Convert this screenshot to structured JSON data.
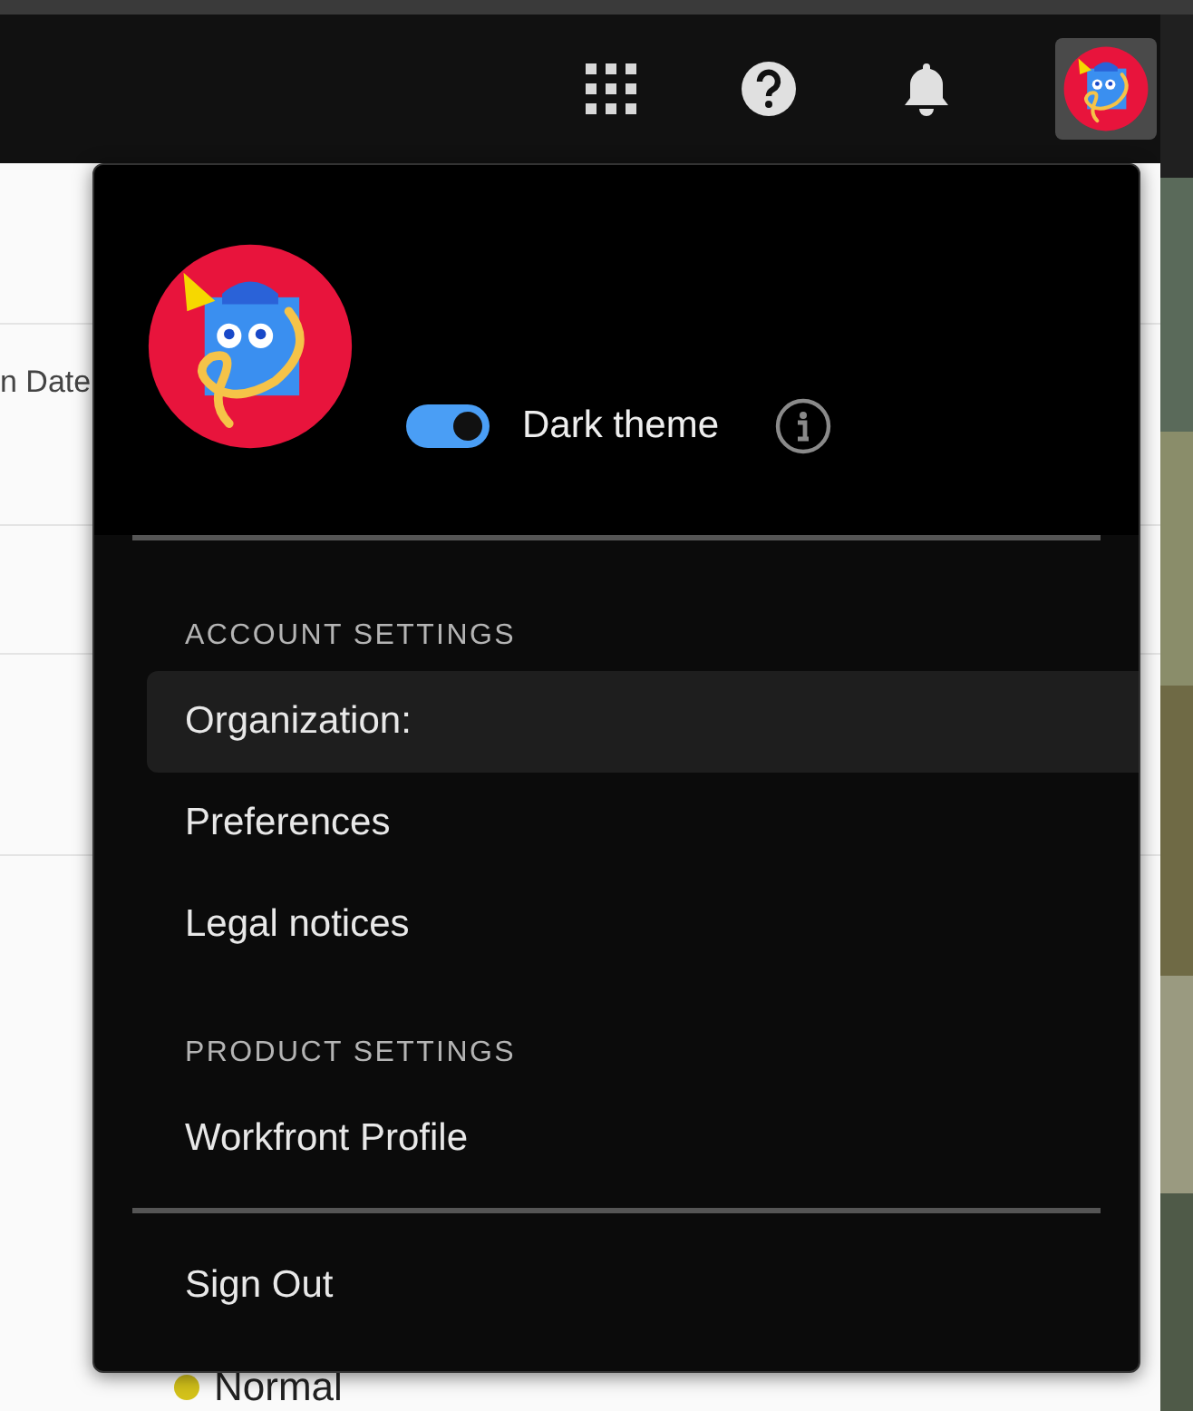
{
  "top_bar": {
    "account_button": {
      "active": true
    }
  },
  "background": {
    "column_header": "n Date",
    "cell_text": "Normal"
  },
  "menu": {
    "dark_theme": {
      "label": "Dark theme",
      "on": true
    },
    "sections": [
      {
        "heading": "ACCOUNT SETTINGS",
        "items": [
          {
            "label": "Organization:",
            "highlighted": true
          },
          {
            "label": "Preferences",
            "highlighted": false
          },
          {
            "label": "Legal notices",
            "highlighted": false
          }
        ]
      },
      {
        "heading": "PRODUCT SETTINGS",
        "items": [
          {
            "label": "Workfront Profile",
            "highlighted": false
          }
        ]
      }
    ],
    "sign_out": "Sign Out"
  }
}
